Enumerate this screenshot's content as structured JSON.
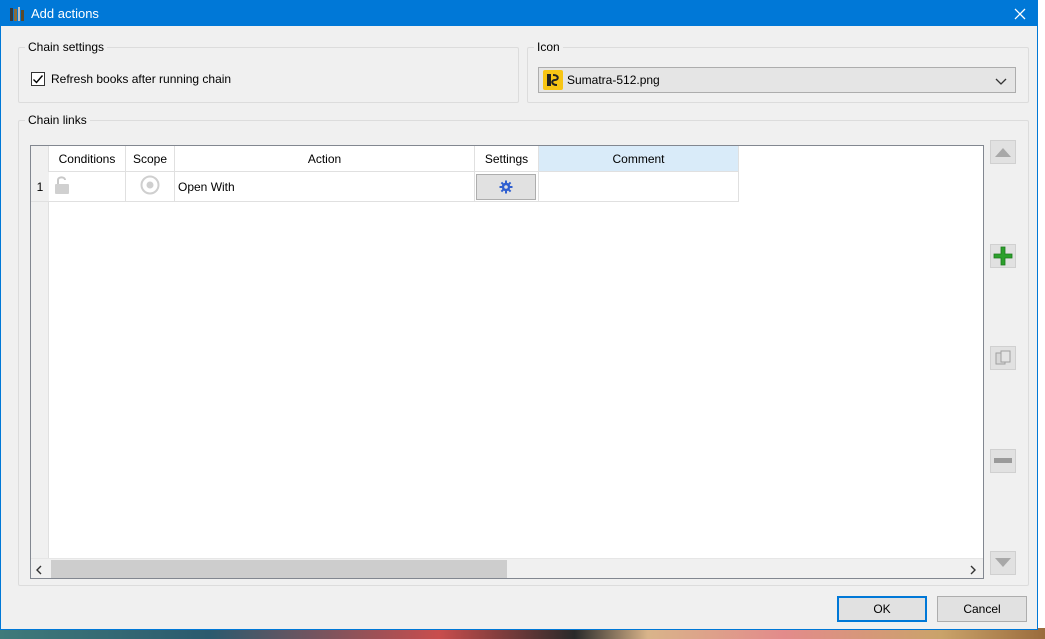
{
  "window": {
    "title": "Add actions"
  },
  "chain_settings": {
    "legend": "Chain settings",
    "refresh_checked": true,
    "refresh_label": "Refresh books after running chain"
  },
  "icon_group": {
    "legend": "Icon",
    "selected": "Sumatra-512.png"
  },
  "chain_links": {
    "legend": "Chain links",
    "columns": [
      "Conditions",
      "Scope",
      "Action",
      "Settings",
      "Comment"
    ],
    "rows": [
      {
        "number": "1",
        "action": "Open With",
        "comment": ""
      }
    ]
  },
  "buttons": {
    "ok": "OK",
    "cancel": "Cancel"
  },
  "colors": {
    "titlebar": "#0078d7",
    "selected_header": "#d9ebf9",
    "add_icon": "#2ca02c",
    "settings_icon": "#2f5fd0"
  },
  "icons": {
    "app": "calibre-books-icon",
    "close": "close-icon",
    "checkbox": "checkmark-icon",
    "combo_item": "sumatra-icon",
    "combo_arrow": "chevron-down-icon",
    "condition": "unlock-icon",
    "scope": "radio-target-icon",
    "settings": "gear-icon",
    "move_up": "arrow-up-icon",
    "add": "plus-icon",
    "copy": "copy-icon",
    "remove": "minus-icon",
    "move_down": "arrow-down-icon"
  }
}
